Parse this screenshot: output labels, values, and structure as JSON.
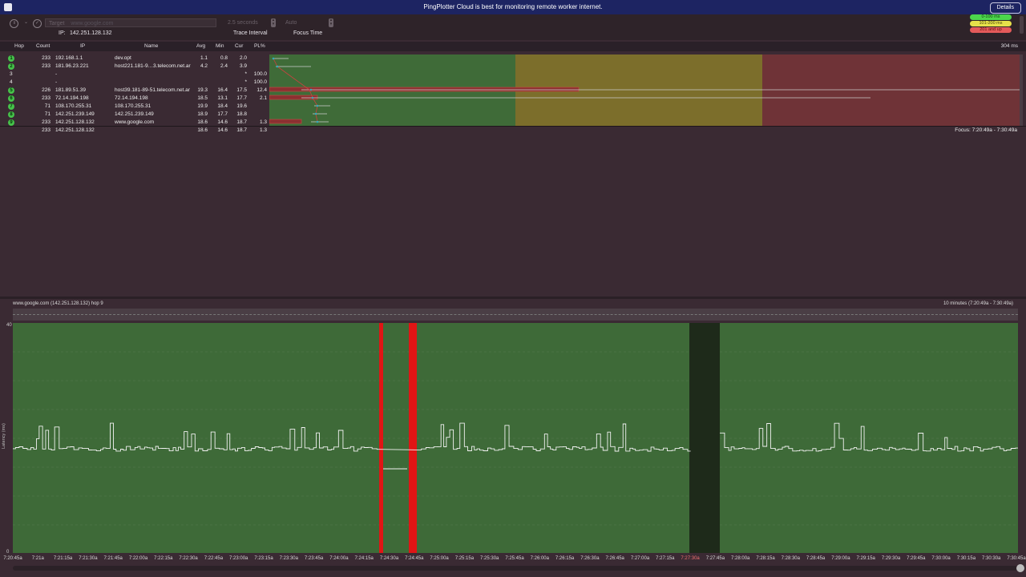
{
  "banner": {
    "message": "PingPlotter Cloud is best for monitoring remote worker internet.",
    "details_label": "Details"
  },
  "toolbar": {
    "target_label": "Target",
    "target_placeholder": "www.google.com",
    "interval_value": "2.5 seconds",
    "focus_value": "Auto",
    "ip_label": "IP:",
    "ip_value": "142.251.128.132",
    "trace_interval_label": "Trace Interval",
    "focus_time_label": "Focus Time"
  },
  "legend": [
    {
      "label": "0-100 ms",
      "color": "#4cd64c"
    },
    {
      "label": "101-200 ms",
      "color": "#e6e04a"
    },
    {
      "label": "201 and up",
      "color": "#e45a5a"
    }
  ],
  "table": {
    "headers": [
      "Hop",
      "Count",
      "IP",
      "Name",
      "Avg",
      "Min",
      "Cur",
      "PL%"
    ],
    "scale_label": "304 ms",
    "rows": [
      {
        "hop": "1",
        "count": "233",
        "ip": "192.168.1.1",
        "name": "dev.opt",
        "avg": "1.1",
        "min": "0.8",
        "cur": "2.0",
        "pl": "",
        "badge": true
      },
      {
        "hop": "2",
        "count": "233",
        "ip": "181.96.23.221",
        "name": "host221.181-9…3.telecom.net.ar",
        "avg": "4.2",
        "min": "2.4",
        "cur": "3.9",
        "pl": "",
        "badge": true
      },
      {
        "hop": "3",
        "count": "",
        "ip": "-",
        "name": "",
        "avg": "",
        "min": "",
        "cur": "*",
        "pl": "100.0",
        "badge": false
      },
      {
        "hop": "4",
        "count": "",
        "ip": "-",
        "name": "",
        "avg": "",
        "min": "",
        "cur": "*",
        "pl": "100.0",
        "badge": false
      },
      {
        "hop": "5",
        "count": "226",
        "ip": "181.89.51.39",
        "name": "host39.181-89-51.telecom.net.ar",
        "avg": "19.3",
        "min": "16.4",
        "cur": "17.5",
        "pl": "12.4",
        "badge": true
      },
      {
        "hop": "6",
        "count": "233",
        "ip": "72.14.194.198",
        "name": "72.14.194.198",
        "avg": "18.5",
        "min": "13.1",
        "cur": "17.7",
        "pl": "2.1",
        "badge": true
      },
      {
        "hop": "7",
        "count": "71",
        "ip": "108.170.255.31",
        "name": "108.170.255.31",
        "avg": "19.9",
        "min": "18.4",
        "cur": "19.6",
        "pl": "",
        "badge": true
      },
      {
        "hop": "8",
        "count": "71",
        "ip": "142.251.239.149",
        "name": "142.251.239.149",
        "avg": "18.9",
        "min": "17.7",
        "cur": "18.8",
        "pl": "",
        "badge": true
      },
      {
        "hop": "9",
        "count": "233",
        "ip": "142.251.128.132",
        "name": "www.google.com",
        "avg": "18.6",
        "min": "14.6",
        "cur": "18.7",
        "pl": "1.3",
        "badge": true
      }
    ],
    "summary": {
      "count": "233",
      "ip": "142.251.128.132",
      "avg": "18.6",
      "min": "14.6",
      "cur": "18.7",
      "pl": "1.3"
    },
    "focus_label": "Focus: 7:20:49a - 7:30:49a"
  },
  "graph": {
    "host_label": "www.google.com (142.251.128.132) hop 9",
    "range_label": "10 minutes (7:20:49a - 7:30:49a)",
    "y_max_label": "40",
    "y_min_label": "0",
    "y_axis_label": "Latency (ms)",
    "x_labels": [
      "7:20:45a",
      "7:21a",
      "7:21:15a",
      "7:21:30a",
      "7:21:45a",
      "7:22:00a",
      "7:22:15a",
      "7:22:30a",
      "7:22:45a",
      "7:23:00a",
      "7:23:15a",
      "7:23:30a",
      "7:23:45a",
      "7:24:00a",
      "7:24:15a",
      "7:24:30a",
      "7:24:45a",
      "7:25:00a",
      "7:25:15a",
      "7:25:30a",
      "7:25:45a",
      "7:26:00a",
      "7:26:15a",
      "7:26:30a",
      "7:26:45a",
      "7:27:00a",
      "7:27:15a",
      "7:27:30a",
      "7:27:45a",
      "7:28:00a",
      "7:28:15a",
      "7:28:30a",
      "7:28:45a",
      "7:29:00a",
      "7:29:15a",
      "7:29:30a",
      "7:29:45a",
      "7:30:00a",
      "7:30:15a",
      "7:30:30a",
      "7:30:45a"
    ],
    "highlight_label": "7:27:30a"
  },
  "colors": {
    "green_zone": "#3f6b38",
    "yellow_zone": "#7c6e2b",
    "red_zone": "#6f3337",
    "loss_bar": "#e01515",
    "gap": "#1e2a1a"
  }
}
